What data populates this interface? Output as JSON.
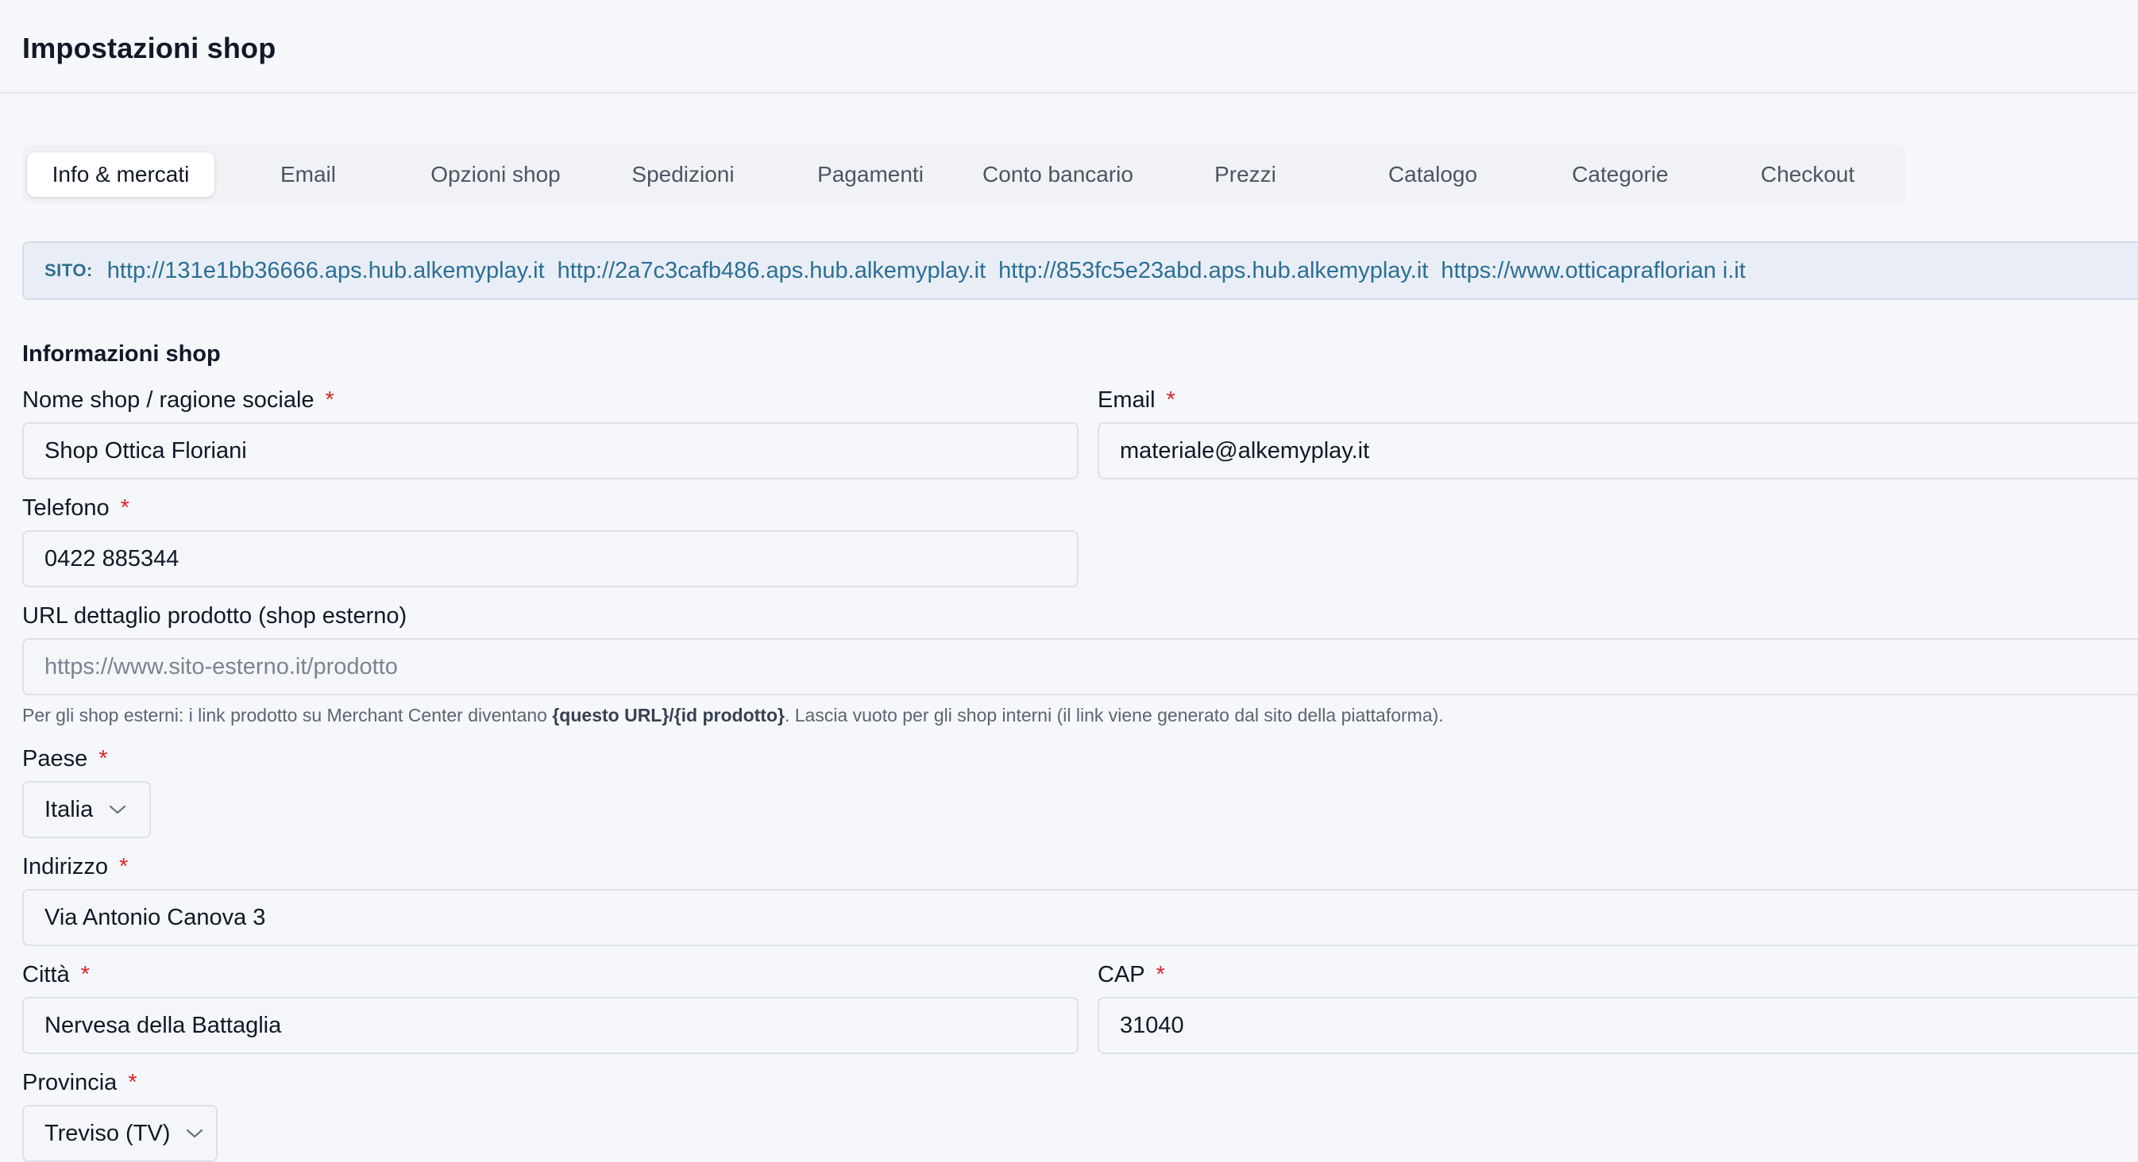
{
  "header": {
    "title": "Impostazioni shop"
  },
  "tabs": [
    {
      "label": "Info & mercati",
      "active": true
    },
    {
      "label": "Email"
    },
    {
      "label": "Opzioni shop"
    },
    {
      "label": "Spedizioni"
    },
    {
      "label": "Pagamenti"
    },
    {
      "label": "Conto bancario"
    },
    {
      "label": "Prezzi"
    },
    {
      "label": "Catalogo"
    },
    {
      "label": "Categorie"
    },
    {
      "label": "Checkout"
    }
  ],
  "sites": {
    "label": "SITO:",
    "links": [
      "http://131e1bb36666.aps.hub.alkemyplay.it",
      "http://2a7c3cafb486.aps.hub.alkemyplay.it",
      "http://853fc5e23abd.aps.hub.alkemyplay.it",
      "https://www.otticapraflorian i.it"
    ]
  },
  "form": {
    "section_title": "Informazioni shop",
    "required_mark": "*",
    "name": {
      "label": "Nome shop / ragione sociale",
      "value": "Shop Ottica Floriani"
    },
    "email": {
      "label": "Email",
      "value": "materiale@alkemyplay.it"
    },
    "phone": {
      "label": "Telefono",
      "value": "0422 885344"
    },
    "product_url": {
      "label": "URL dettaglio prodotto (shop esterno)",
      "placeholder": "https://www.sito-esterno.it/prodotto",
      "help_prefix": "Per gli shop esterni: i link prodotto su Merchant Center diventano ",
      "help_code": "{questo URL}/{id prodotto}",
      "help_suffix": ". Lascia vuoto per gli shop interni (il link viene generato dal sito della piattaforma)."
    },
    "country": {
      "label": "Paese",
      "value": "Italia"
    },
    "address": {
      "label": "Indirizzo",
      "value": "Via Antonio Canova 3"
    },
    "city": {
      "label": "Città",
      "value": "Nervesa della Battaglia"
    },
    "cap": {
      "label": "CAP",
      "value": "31040"
    },
    "province": {
      "label": "Provincia",
      "value": "Treviso (TV)"
    }
  },
  "icons": {
    "select_arrow": "chevron-down-icon"
  },
  "colors": {
    "required": "#dc2626",
    "link": "#2b6f95",
    "banner_bg": "#e9eef6"
  }
}
